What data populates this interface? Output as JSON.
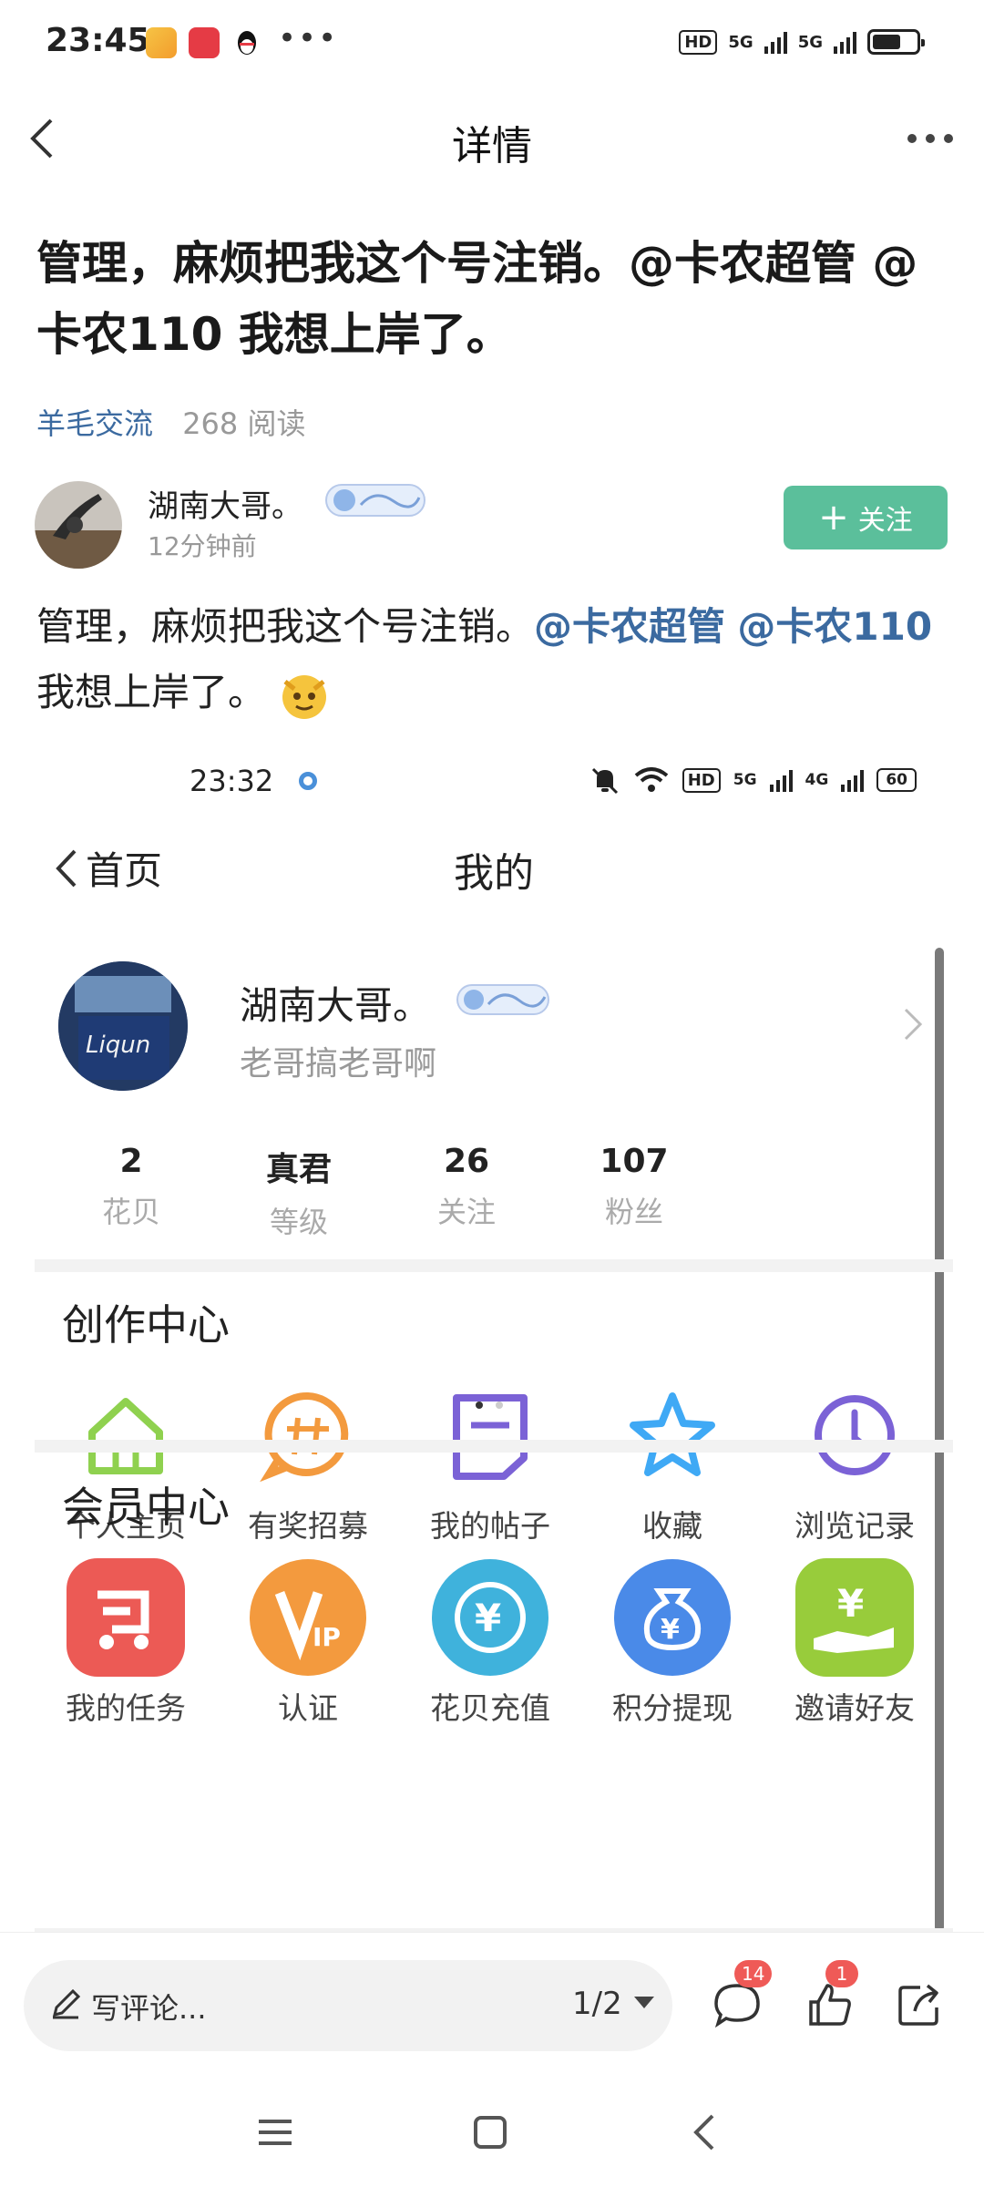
{
  "status_bar": {
    "time": "23:45",
    "dots": "•••",
    "hd": "HD",
    "sim1": "5G",
    "sim2": "5G"
  },
  "nav": {
    "title": "详情"
  },
  "post": {
    "title": "管理，麻烦把我这个号注销。@卡农超管 @卡农110 我想上岸了。",
    "board": "羊毛交流",
    "reads": "268 阅读",
    "author": {
      "name": "湖南大哥。",
      "time": "12分钟前"
    },
    "follow_label": "关注",
    "body_text_1": "管理，麻烦把我这个号注销。",
    "mention_1": "@卡农超管",
    "mention_2": "@卡农110",
    "body_text_2": " 我想上岸了。"
  },
  "screenshot": {
    "status_time": "23:32",
    "hd": "HD",
    "sim1": "5G",
    "sim2": "4G",
    "battery": "60",
    "back_label": "首页",
    "title": "我的",
    "profile": {
      "name": "湖南大哥。",
      "bio": "老哥搞老哥啊"
    },
    "stats": [
      {
        "value": "2",
        "label": "花贝"
      },
      {
        "value": "真君",
        "label": "等级"
      },
      {
        "value": "26",
        "label": "关注"
      },
      {
        "value": "107",
        "label": "粉丝"
      }
    ],
    "creation_center": {
      "title": "创作中心",
      "items": [
        {
          "label": "个人主页",
          "icon": "home-icon"
        },
        {
          "label": "有奖招募",
          "icon": "hashtag-icon"
        },
        {
          "label": "我的帖子",
          "icon": "document-icon"
        },
        {
          "label": "收藏",
          "icon": "star-icon"
        },
        {
          "label": "浏览记录",
          "icon": "clock-icon"
        }
      ]
    },
    "member_center": {
      "title": "会员中心",
      "items": [
        {
          "label": "我的任务",
          "icon": "task-icon",
          "color": "#ec5a55"
        },
        {
          "label": "认证",
          "icon": "vip-icon",
          "color": "#f39a3e"
        },
        {
          "label": "花贝充值",
          "icon": "yuan-recharge-icon",
          "color": "#3fb2dc"
        },
        {
          "label": "积分提现",
          "icon": "money-bag-icon",
          "color": "#4a8ae8"
        },
        {
          "label": "邀请好友",
          "icon": "invite-yuan-icon",
          "color": "#98cc3b"
        }
      ]
    }
  },
  "bottom_bar": {
    "comment_placeholder": "写评论...",
    "page_indicator": "1/2",
    "comment_count": "14",
    "like_count": "1"
  },
  "colors": {
    "accent_green": "#5bbf9b",
    "link_blue": "#3b6aa0",
    "badge_red": "#ef5a57"
  }
}
